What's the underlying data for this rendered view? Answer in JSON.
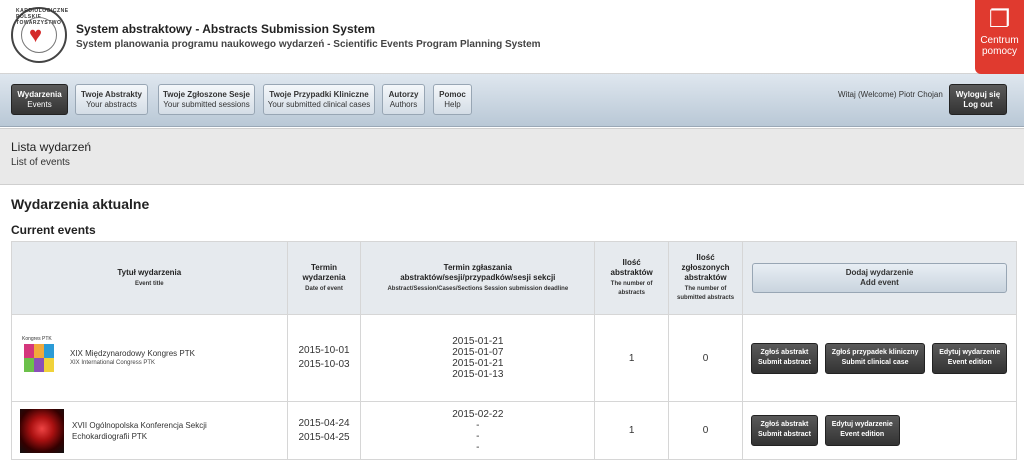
{
  "header": {
    "logo_text": "KARDIOLOGICZNE POLSKIE TOWARZYSTWO",
    "title": "System abstraktowy - Abstracts Submission System",
    "subtitle": "System planowania programu naukowego wydarzeń - Scientific Events Program Planning System",
    "help_center": {
      "line1": "Centrum",
      "line2": "pomocy",
      "icon": "help-book-icon"
    }
  },
  "nav": {
    "items": [
      {
        "pl": "Wydarzenia",
        "en": "Events",
        "active": true
      },
      {
        "pl": "Twoje Abstrakty",
        "en": "Your abstracts",
        "active": false
      },
      {
        "pl": "Twoje Zgłoszone Sesje",
        "en": "Your submitted sessions",
        "active": false
      },
      {
        "pl": "Twoje Przypadki Kliniczne",
        "en": "Your submitted clinical cases",
        "active": false
      },
      {
        "pl": "Autorzy",
        "en": "Authors",
        "active": false
      },
      {
        "pl": "Pomoc",
        "en": "Help",
        "active": false
      }
    ],
    "welcome": "Witaj (Welcome) Piotr Chojan",
    "logout": {
      "pl": "Wyloguj się",
      "en": "Log out"
    }
  },
  "page": {
    "heading_pl": "Lista wydarzeń",
    "heading_en": "List of events",
    "section_title": "Wydarzenia aktualne",
    "section_sub": "Current events"
  },
  "table": {
    "headers": {
      "title": {
        "pl": "Tytuł wydarzenia",
        "en": "Event title"
      },
      "date": {
        "pl1": "Termin",
        "pl2": "wydarzenia",
        "en": "Date of event"
      },
      "deadline": {
        "pl1": "Termin zgłaszania",
        "pl2": "abstraktów/sesji/przypadków/sesji sekcji",
        "en": "Abstract/Session/Cases/Sections Session submission deadline"
      },
      "abstracts": {
        "pl1": "Ilość",
        "pl2": "abstraktów",
        "en1": "The number of",
        "en2": "abstracts"
      },
      "sessions": {
        "pl1": "Ilość",
        "pl2": "zgłoszonych",
        "pl3": "abstraktów",
        "en1": "The number of",
        "en2": "submitted abstracts"
      },
      "add_event": {
        "pl": "Dodaj wydarzenie",
        "en": "Add event"
      }
    },
    "rows": [
      {
        "title_pl": "XIX Międzynarodowy Kongres PTK",
        "title_en": "XIX International Congress PTK",
        "thumb_text": "Kongres PTK",
        "date_start": "2015-10-01",
        "date_end": "2015-10-03",
        "deadlines": [
          "2015-01-21",
          "2015-01-07",
          "2015-01-21",
          "2015-01-13"
        ],
        "abstracts": "1",
        "sessions": "0",
        "buttons": [
          {
            "pl": "Zgłoś abstrakt",
            "en": "Submit abstract"
          },
          {
            "pl": "Zgłoś przypadek kliniczny",
            "en": "Submit clinical case"
          },
          {
            "pl": "Edytuj wydarzenie",
            "en": "Event edition"
          }
        ]
      },
      {
        "title_pl": "XVII Ogólnopolska Konferencja Sekcji",
        "title_pl2": "Echokardiografii PTK",
        "date_start": "2015-04-24",
        "date_end": "2015-04-25",
        "deadlines": [
          "2015-02-22",
          "-",
          "-",
          "-"
        ],
        "abstracts": "1",
        "sessions": "0",
        "buttons": [
          {
            "pl": "Zgłoś abstrakt",
            "en": "Submit abstract"
          },
          {
            "pl": "Edytuj wydarzenie",
            "en": "Event edition"
          }
        ]
      }
    ]
  }
}
